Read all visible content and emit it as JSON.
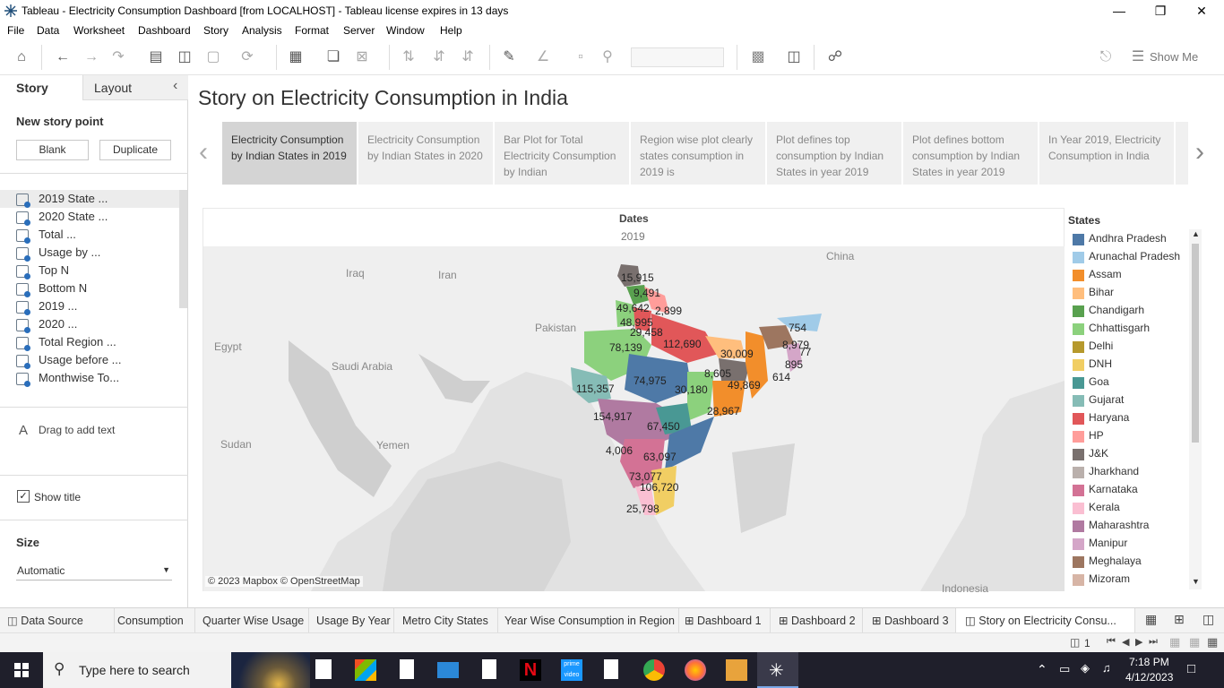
{
  "window": {
    "title": "Tableau - Electricity Consumption Dashboard [from LOCALHOST] - Tableau license expires in 13 days"
  },
  "menu": [
    "File",
    "Data",
    "Worksheet",
    "Dashboard",
    "Story",
    "Analysis",
    "Format",
    "Server",
    "Window",
    "Help"
  ],
  "toolbar": {
    "show_me": "Show Me"
  },
  "left_pane": {
    "tab_story": "Story",
    "tab_layout": "Layout",
    "new_story_point": "New story point",
    "blank_button": "Blank",
    "duplicate_button": "Duplicate",
    "sheets": [
      "2019 State ...",
      "2020 State ...",
      "Total ...",
      "Usage by ...",
      "Top N",
      "Bottom N",
      "2019 ...",
      "2020 ...",
      "Total Region ...",
      "Usage before ...",
      "Monthwise To..."
    ],
    "drag_text": "Drag to add text",
    "show_title": "Show title",
    "size_label": "Size",
    "size_value": "Automatic"
  },
  "story": {
    "title": "Story on Electricity Consumption in India",
    "points": [
      "Electricity Consumption by Indian States in 2019",
      "Electricity Consumption by Indian States in 2020",
      "Bar Plot for Total Electricity Consumption by Indian",
      "Region wise plot clearly states consumption in 2019 is",
      "Plot defines top consumption by Indian States in year 2019",
      "Plot defines bottom consumption by Indian States in year 2019",
      "In Year 2019, Electricity Consumption in India"
    ]
  },
  "viz": {
    "header": "Dates",
    "year": "2019",
    "attribution": "© 2023 Mapbox © OpenStreetMap",
    "map_labels": [
      "Iraq",
      "Iran",
      "Egypt",
      "Saudi Arabia",
      "Pakistan",
      "China",
      "Sudan",
      "Yemen",
      "Indonesia"
    ],
    "values": [
      "15,915",
      "9,491",
      "49,642",
      "48,995",
      "2,899",
      "29,458",
      "112,690",
      "78,139",
      "754",
      "30,009",
      "8,979",
      "77",
      "895",
      "614",
      "8,605",
      "49,869",
      "115,357",
      "74,975",
      "30,180",
      "28,967",
      "154,917",
      "67,450",
      "4,006",
      "63,097",
      "73,077",
      "106,720",
      "25,798"
    ]
  },
  "legend": {
    "title": "States",
    "items": [
      {
        "name": "Andhra Pradesh",
        "color": "#4e79a7"
      },
      {
        "name": "Arunachal Pradesh",
        "color": "#a0cbe8"
      },
      {
        "name": "Assam",
        "color": "#f28e2b"
      },
      {
        "name": "Bihar",
        "color": "#ffbe7d"
      },
      {
        "name": "Chandigarh",
        "color": "#59a14f"
      },
      {
        "name": "Chhattisgarh",
        "color": "#8cd17d"
      },
      {
        "name": "Delhi",
        "color": "#b6992d"
      },
      {
        "name": "DNH",
        "color": "#f1ce63"
      },
      {
        "name": "Goa",
        "color": "#499894"
      },
      {
        "name": "Gujarat",
        "color": "#86bcb6"
      },
      {
        "name": "Haryana",
        "color": "#e15759"
      },
      {
        "name": "HP",
        "color": "#ff9d9a"
      },
      {
        "name": "J&K",
        "color": "#79706e"
      },
      {
        "name": "Jharkhand",
        "color": "#bab0ac"
      },
      {
        "name": "Karnataka",
        "color": "#d37295"
      },
      {
        "name": "Kerala",
        "color": "#fabfd2"
      },
      {
        "name": "Maharashtra",
        "color": "#b07aa1"
      },
      {
        "name": "Manipur",
        "color": "#d4a6c8"
      },
      {
        "name": "Meghalaya",
        "color": "#9d7660"
      },
      {
        "name": "Mizoram",
        "color": "#d7b5a6"
      }
    ]
  },
  "bottom_tabs": [
    "Data Source",
    "Consumption",
    "Quarter Wise Usage",
    "Usage By Year",
    "Metro City States",
    "Year Wise Consumption in Region",
    "Dashboard 1",
    "Dashboard 2",
    "Dashboard 3",
    "Story on Electricity Consu..."
  ],
  "status": {
    "count": "1"
  },
  "taskbar": {
    "search_placeholder": "Type here to search",
    "time": "7:18 PM",
    "date": "4/12/2023"
  }
}
